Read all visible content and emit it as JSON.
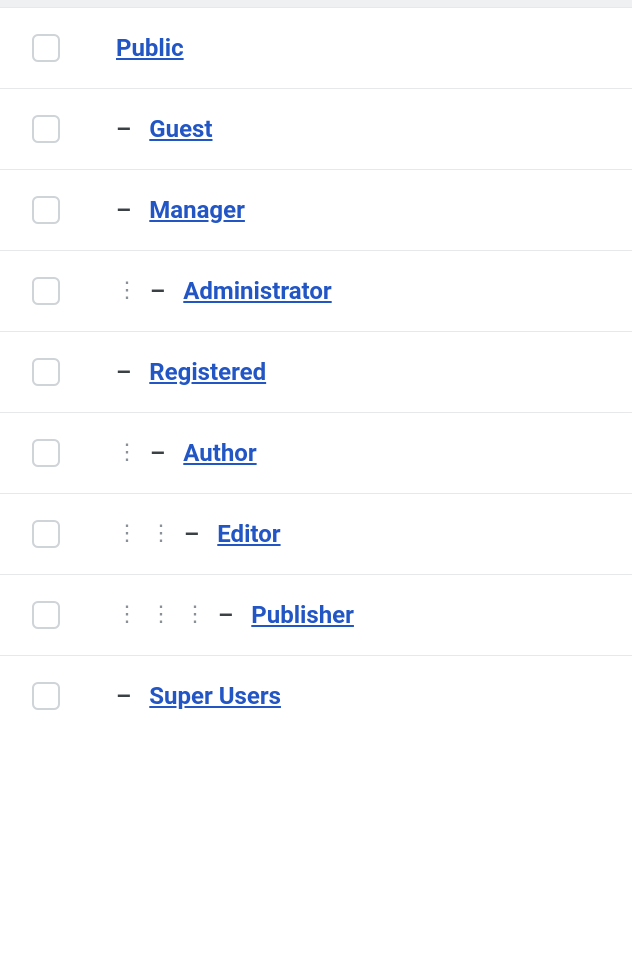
{
  "groups": [
    {
      "label": "Public",
      "depth": 0
    },
    {
      "label": "Guest",
      "depth": 1
    },
    {
      "label": "Manager",
      "depth": 1
    },
    {
      "label": "Administrator",
      "depth": 2
    },
    {
      "label": "Registered",
      "depth": 1
    },
    {
      "label": "Author",
      "depth": 2
    },
    {
      "label": "Editor",
      "depth": 3
    },
    {
      "label": "Publisher",
      "depth": 4
    },
    {
      "label": "Super Users",
      "depth": 1
    }
  ]
}
